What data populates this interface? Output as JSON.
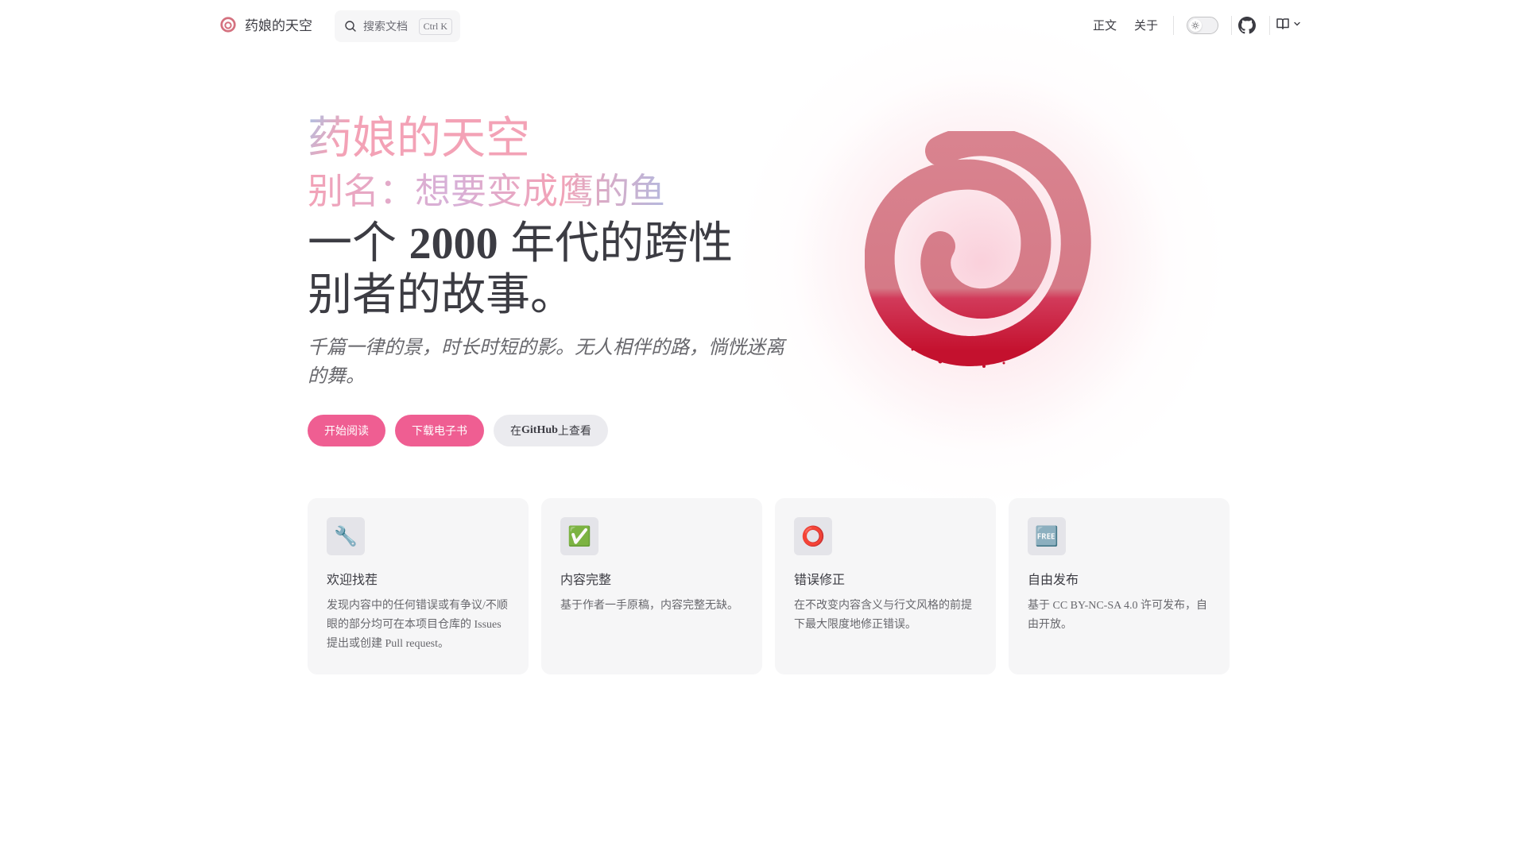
{
  "nav": {
    "title": "药娘的天空",
    "search_placeholder": "搜索文档",
    "search_shortcut": "Ctrl K",
    "links": [
      "正文",
      "关于"
    ]
  },
  "hero": {
    "name": "药娘的天空",
    "alias": "别名：想要变成鹰的鱼",
    "text_line1_a": "一个 ",
    "text_line1_num": "2000",
    "text_line1_b": " 年代的跨性",
    "text_line2": "别者的故事。",
    "tagline": "千篇一律的景，时长时短的影。无人相伴的路，惝恍迷离的舞。",
    "actions": {
      "start": "开始阅读",
      "download": "下载电子书",
      "github_prefix": "在 ",
      "github_brand": "GitHub",
      "github_suffix": " 上查看"
    }
  },
  "features": [
    {
      "icon": "🔧",
      "icon_name": "wrench-icon",
      "title": "欢迎找茬",
      "details": "发现内容中的任何错误或有争议/不顺眼的部分均可在本项目仓库的 Issues 提出或创建 Pull request。"
    },
    {
      "icon": "✅",
      "icon_name": "check-mark-icon",
      "title": "内容完整",
      "details": "基于作者一手原稿，内容完整无缺。"
    },
    {
      "icon": "⭕",
      "icon_name": "hollow-circle-icon",
      "title": "错误修正",
      "details": "在不改变内容含义与行文风格的前提下最大限度地修正错误。"
    },
    {
      "icon": "🆓",
      "icon_name": "free-icon",
      "title": "自由发布",
      "details": "基于 CC BY-NC-SA 4.0 许可发布，自由开放。"
    }
  ],
  "colors": {
    "brand": "#ef5e92",
    "name_gradient": "#f3a2b6",
    "logo": "#d4717f"
  }
}
